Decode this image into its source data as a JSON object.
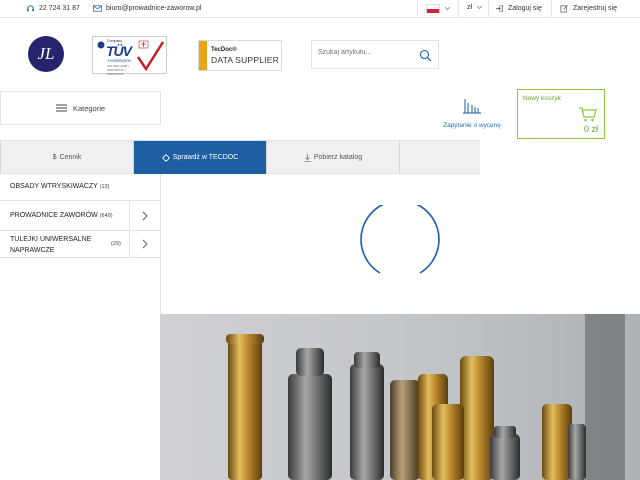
{
  "topbar": {
    "phone": "22 724 31 87",
    "email": "biuro@prowadnice-zaworow.pl",
    "currency": "zł",
    "login": "Zaloguj się",
    "register": "Zarejestruj się"
  },
  "header": {
    "logo_text": "JL",
    "tuv": {
      "caption": "Company",
      "brand": "TÜV",
      "sub": "THÜRINGEN",
      "note": "ISO 9001:2008 | ZERTIFIKAT | ZERTIFIKAT"
    },
    "tecdoc": {
      "brand": "TecDoc®",
      "label": "DATA SUPPLIER"
    },
    "search": {
      "placeholder": "Szukaj artykułu..."
    }
  },
  "nav": {
    "categories_label": "Kategorie",
    "quote_label": "Zapytanie o wycenę",
    "cart": {
      "title": "Nowy koszyk",
      "total": "0 zł"
    }
  },
  "tabs": [
    {
      "label": "Cennik",
      "icon": "dollar-icon"
    },
    {
      "label": "Sprawdź w TECDOC",
      "icon": "crosshair-icon"
    },
    {
      "label": "Pobierz katalog",
      "icon": "download-icon"
    }
  ],
  "sidebar": {
    "items": [
      {
        "label": "OBSADY WTRYSKIWACZY",
        "count": "(13)"
      },
      {
        "label": "PROWADNICE ZAWORÓW",
        "count": "(649)"
      },
      {
        "label_line1": "TULEJKI UNIWERSALNE",
        "label_line2": "NAPRAWCZE",
        "count": "(29)"
      }
    ]
  },
  "colors": {
    "brand_blue": "#1e5ea3",
    "cart_green": "#8cc63e",
    "logo_navy": "#27246e"
  }
}
